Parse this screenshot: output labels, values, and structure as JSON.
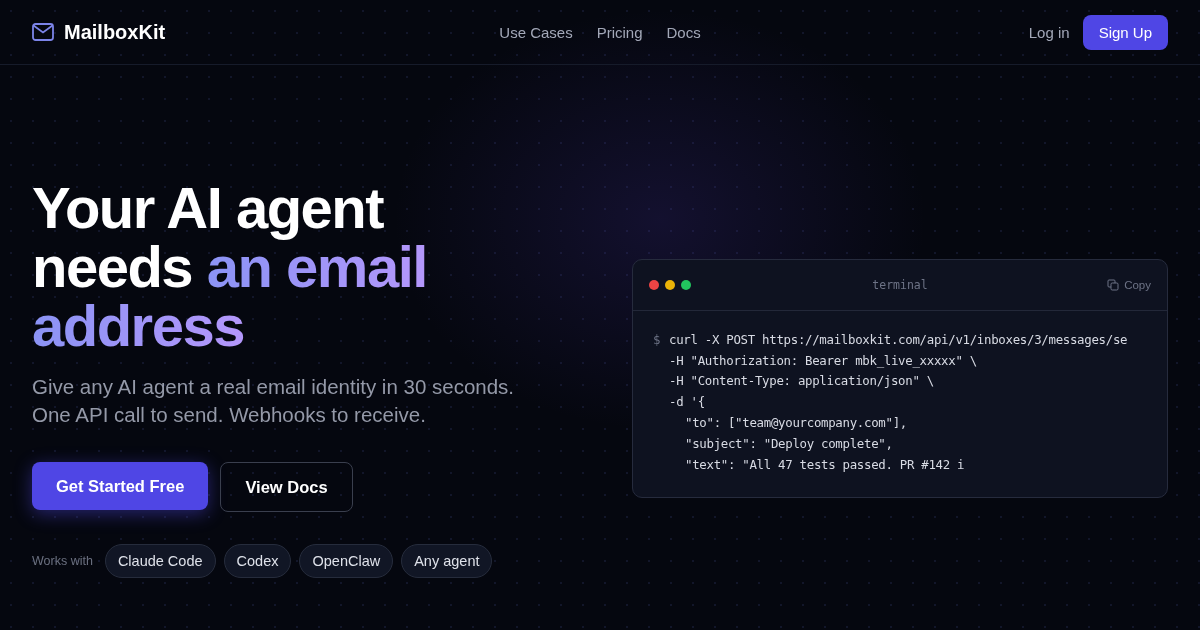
{
  "nav": {
    "brand": "MailboxKit",
    "links": [
      "Use Cases",
      "Pricing",
      "Docs"
    ],
    "login": "Log in",
    "signup": "Sign Up"
  },
  "hero": {
    "headline": [
      [
        {
          "text": "Your AI agent",
          "accent": false
        }
      ],
      [
        {
          "text": "needs ",
          "accent": false
        },
        {
          "text": "an email",
          "accent": true
        }
      ],
      [
        {
          "text": "address",
          "accent": true
        }
      ]
    ],
    "subtitle": [
      "Give any AI agent a real email identity in 30 seconds.",
      "One API call to send. Webhooks to receive."
    ],
    "primary_button": "Get Started Free",
    "secondary_button": "View Docs",
    "works_with_label": "Works with",
    "agents": [
      "Claude Code",
      "Codex",
      "OpenClaw",
      "Any agent"
    ]
  },
  "terminal": {
    "title": "terminal",
    "copy": "Copy",
    "prompt": "$",
    "lines": [
      {
        "text": "curl -X POST https://mailboxkit.com/api/v1/inboxes/3/messages/se",
        "children": [
          {
            "text": "-H \"Authorization: Bearer mbk_live_xxxxx\" \\"
          },
          {
            "text": "-H \"Content-Type: application/json\" \\"
          },
          {
            "text": "-d '{",
            "children": [
              {
                "text": "\"to\": [\"team@yourcompany.com\"],"
              },
              {
                "text": "\"subject\": \"Deploy complete\","
              },
              {
                "text": "\"text\": \"All 47 tests passed. PR #142 i"
              }
            ]
          }
        ]
      }
    ]
  }
}
